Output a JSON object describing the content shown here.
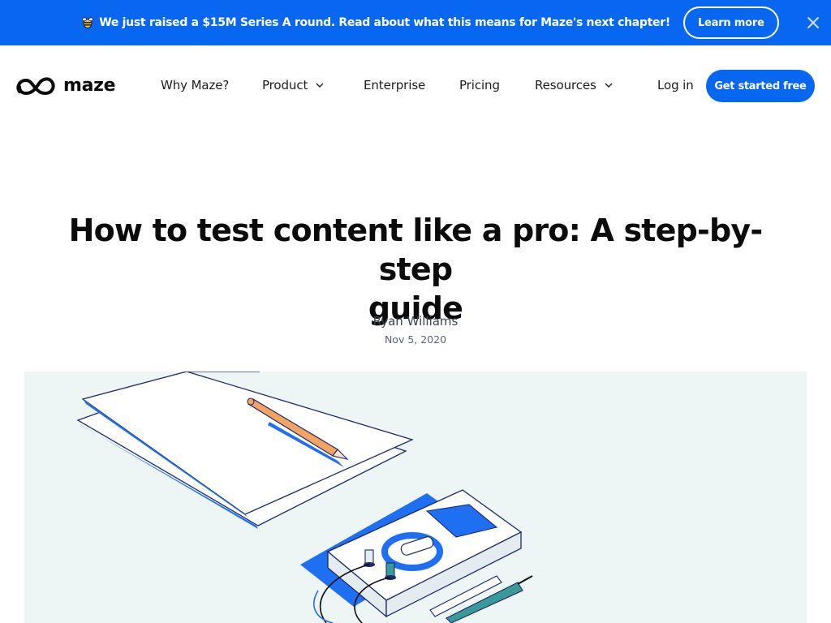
{
  "banner": {
    "text": "We just raised a $15M Series A round. Read about what this means for Maze's next chapter!",
    "button_label": "Learn more",
    "emoji_icon": "bee-icon",
    "close_icon": "close-icon"
  },
  "nav": {
    "logo_text": "maze",
    "items": [
      {
        "label": "Why Maze?"
      },
      {
        "label": "Product",
        "has_dropdown": true
      },
      {
        "label": "Enterprise"
      },
      {
        "label": "Pricing"
      },
      {
        "label": "Resources",
        "has_dropdown": true
      }
    ],
    "login_label": "Log in",
    "cta_label": "Get started free"
  },
  "article": {
    "title_line1": "How to test content like a pro: A step-by-step",
    "title_line2": "guide",
    "author": "Ryan Williams",
    "date": "Nov 5, 2020"
  },
  "colors": {
    "brand_blue": "#0867f0",
    "hero_background": "#eef5f5",
    "pencil_orange": "#f4a460",
    "teal": "#3a9a9a",
    "ink": "#0b0b0b"
  }
}
